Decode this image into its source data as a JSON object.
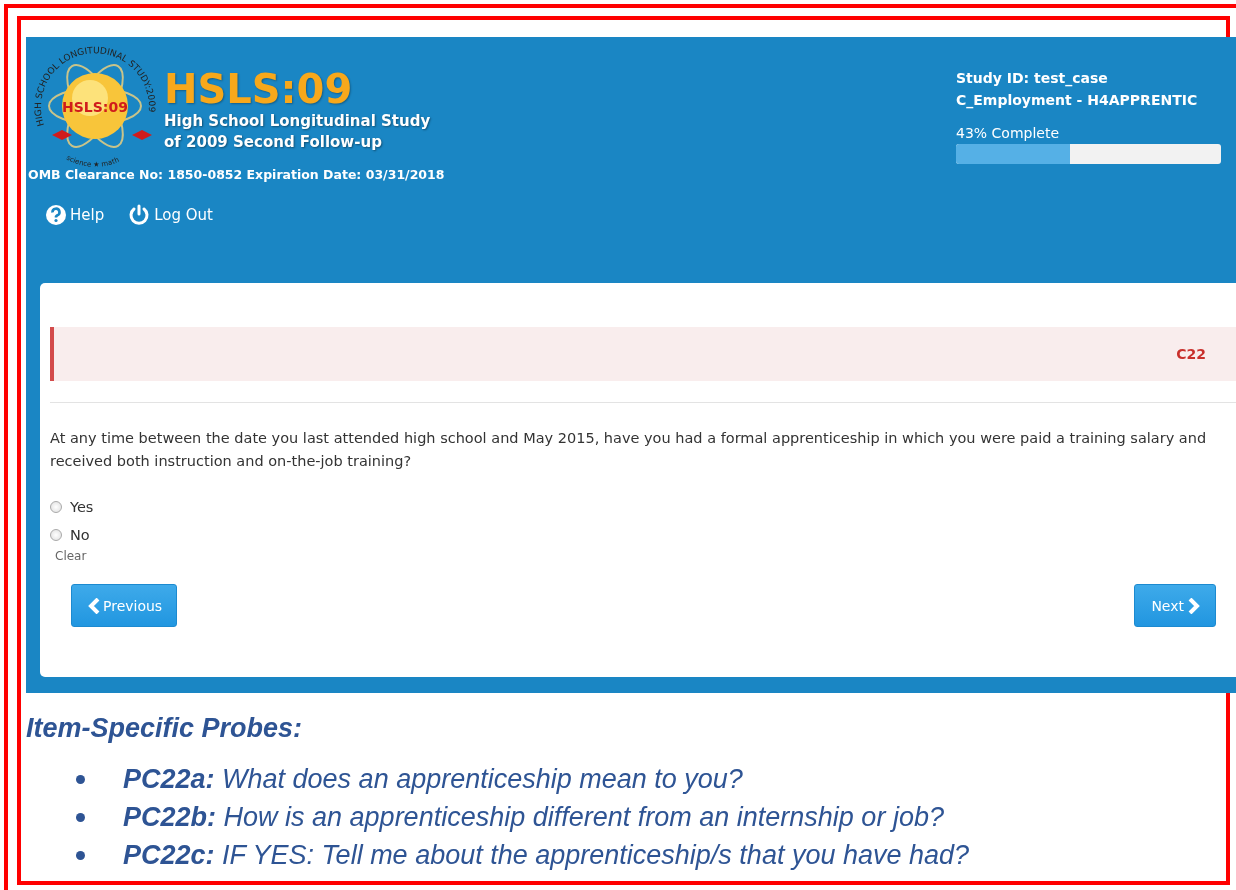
{
  "header": {
    "logo": {
      "center_text": "HSLS:09",
      "ring_text": "HIGH SCHOOL LONGITUDINAL STUDY:2009",
      "bottom_text": "science ★ math"
    },
    "title": "HSLS:09",
    "subtitle_line_1": "High School Longitudinal Study",
    "subtitle_line_2": "of 2009 Second Follow-up",
    "omb": "OMB Clearance No: 1850-0852 Expiration Date: 03/31/2018",
    "links": [
      {
        "kind": "help",
        "label": "Help"
      },
      {
        "kind": "logout",
        "label": "Log Out"
      }
    ],
    "study_id": "Study ID: test_case",
    "section": "C_Employment - H4APPRENTIC",
    "progress": {
      "label": "43% Complete",
      "level": 0.43
    }
  },
  "question": {
    "code": "C22",
    "text": "At any time between the date you last attended high school and May 2015, have you had a formal apprenticeship in which you were paid a training salary and received both instruction and on-the-job training?",
    "options": [
      {
        "label": "Yes",
        "selected": false
      },
      {
        "label": "No",
        "selected": false
      }
    ],
    "clear": "Clear",
    "previous": "Previous",
    "next": "Next"
  },
  "probes": {
    "title": "Item-Specific Probes:",
    "items": [
      {
        "text": "**PC22a:** What does an apprenticeship mean to you?"
      },
      {
        "text": "**PC22b:** How is an apprenticeship different from an internship or job?"
      },
      {
        "text": "**PC22c:** IF YES: Tell me about the apprenticeship/s that you have had?"
      }
    ]
  }
}
